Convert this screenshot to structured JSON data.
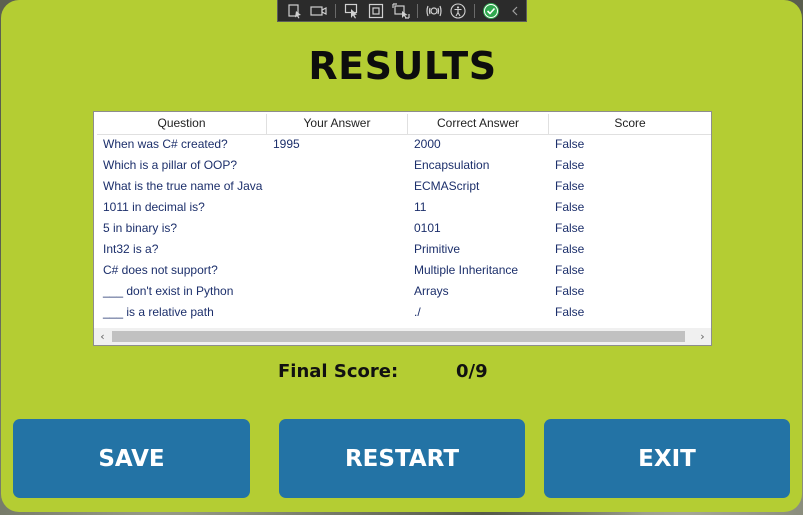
{
  "title": "RESULTS",
  "table": {
    "headers": [
      "Question",
      "Your Answer",
      "Correct Answer",
      "Score"
    ],
    "rows": [
      [
        "When was C# created?",
        "1995",
        "2000",
        "False"
      ],
      [
        "Which is a pillar of OOP?",
        "",
        "Encapsulation",
        "False"
      ],
      [
        "What is the true name of Java",
        "",
        "ECMAScript",
        "False"
      ],
      [
        "1011 in decimal is?",
        "",
        "11",
        "False"
      ],
      [
        "5 in binary is?",
        "",
        "0101",
        "False"
      ],
      [
        "Int32 is a?",
        "",
        "Primitive",
        "False"
      ],
      [
        "C# does not support?",
        "",
        "Multiple Inheritance",
        "False"
      ],
      [
        "___ don't exist in Python",
        "",
        "Arrays",
        "False"
      ],
      [
        "___ is a relative path",
        "",
        "./",
        "False"
      ]
    ]
  },
  "final_score": {
    "label": "Final Score:",
    "value": "0/9"
  },
  "buttons": {
    "save": "SAVE",
    "restart": "RESTART",
    "exit": "EXIT"
  },
  "scroll_arrows": {
    "left": "‹",
    "right": "›"
  },
  "colors": {
    "window_bg": "#b4cd33",
    "button_bg": "#2373a5",
    "cell_text": "#1c2f6b"
  },
  "devbar_icons": [
    "select-element-icon",
    "video-icon",
    "pointer-select-icon",
    "frame-icon",
    "layout-adorner-icon",
    "hot-reload-icon",
    "accessibility-icon",
    "check-icon",
    "collapse-chevron-icon"
  ]
}
